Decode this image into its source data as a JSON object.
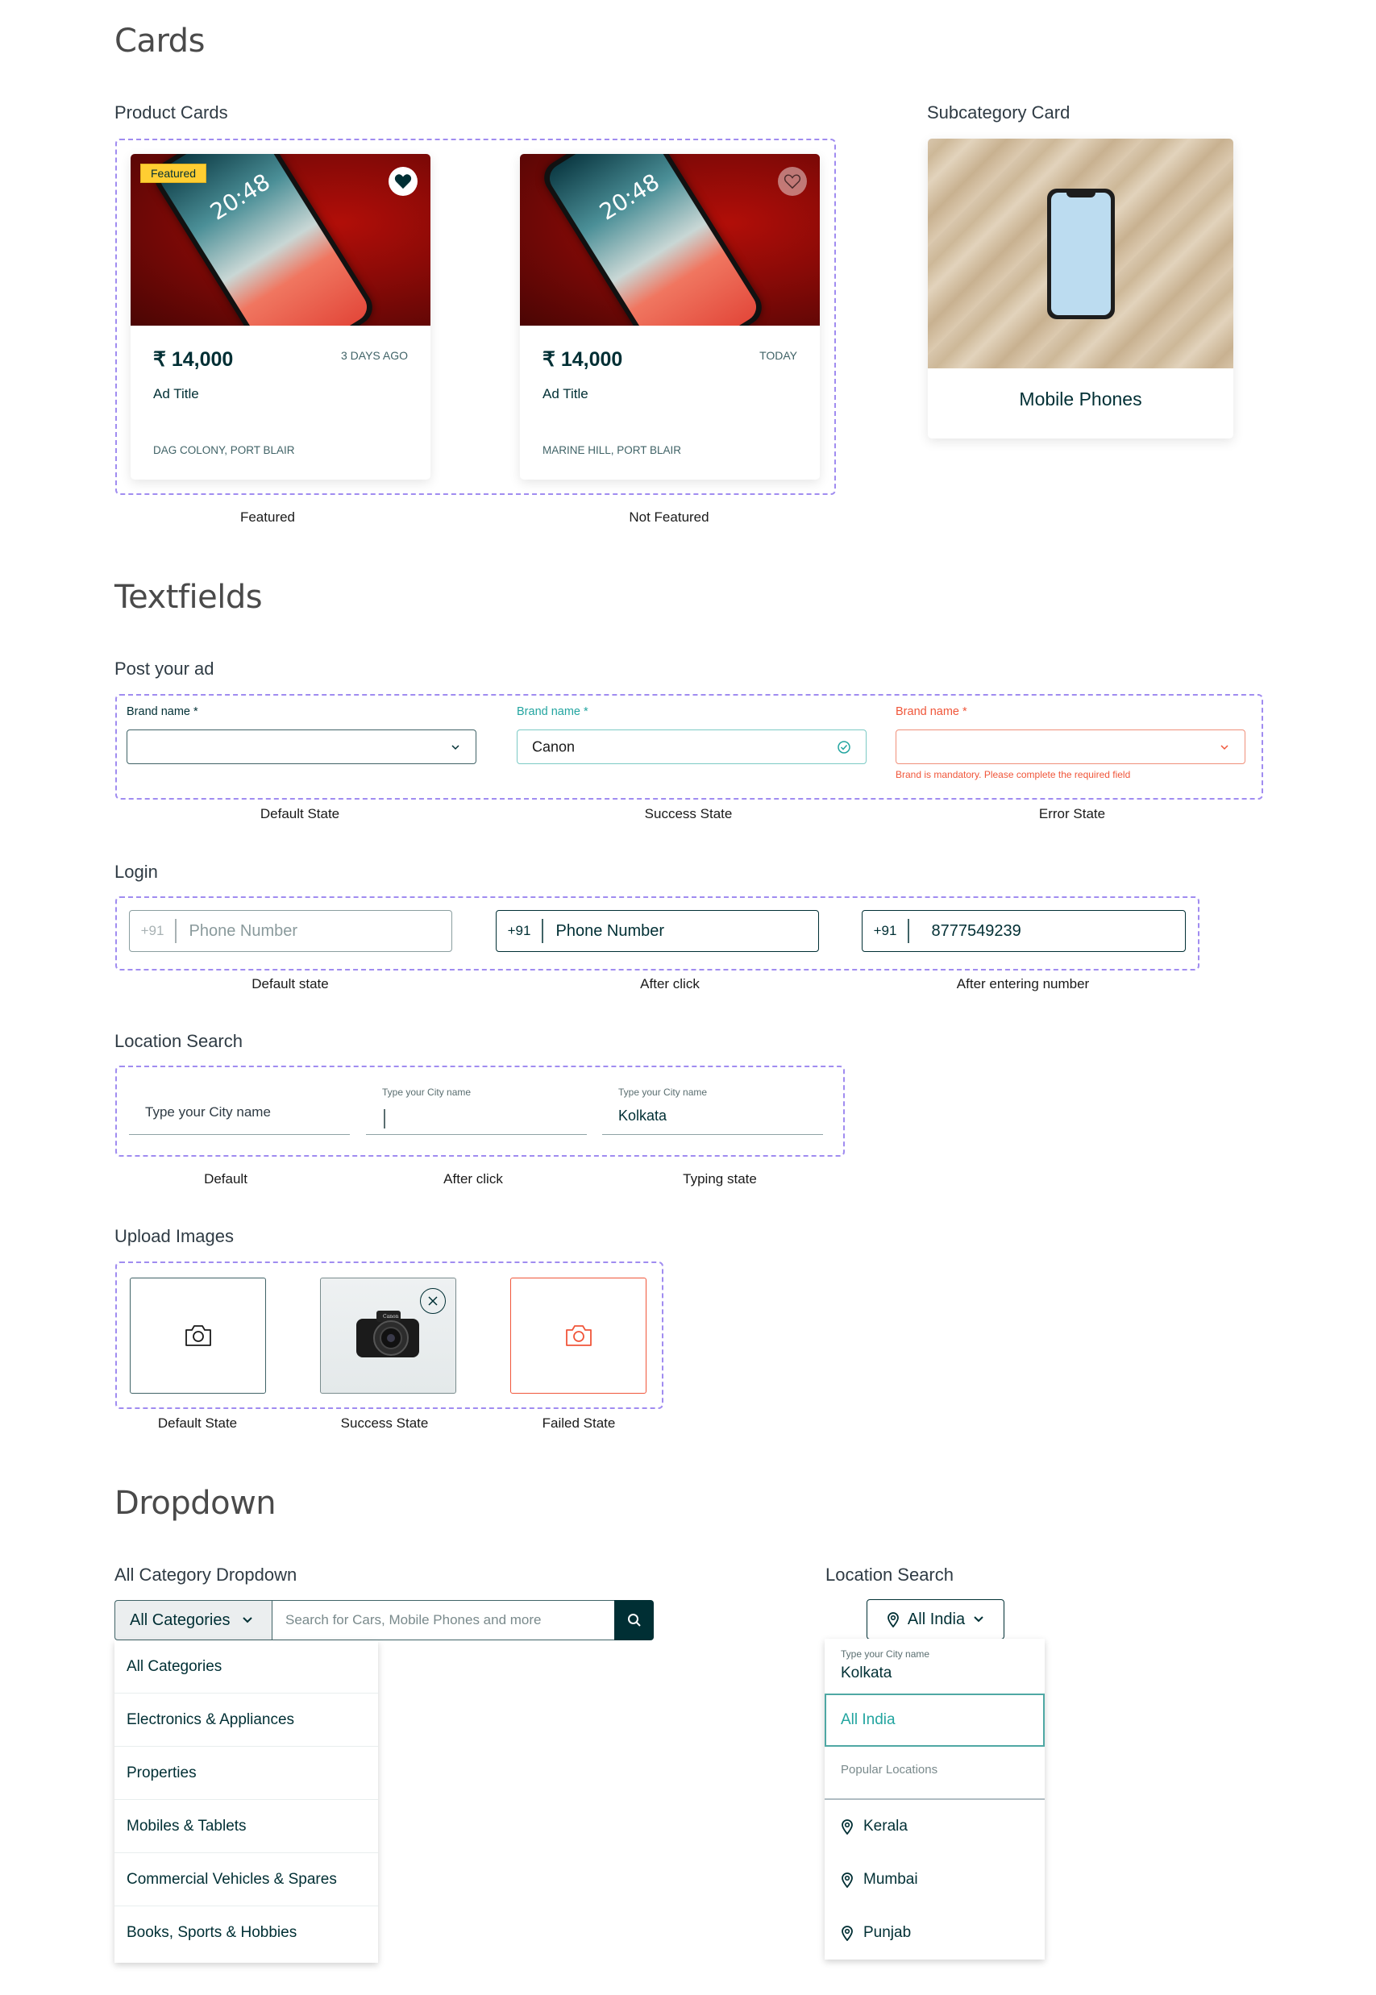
{
  "sections": {
    "cards": "Cards",
    "textfields": "Textfields",
    "dropdown": "Dropdown"
  },
  "product_cards": {
    "heading": "Product Cards",
    "items": [
      {
        "badge": "Featured",
        "favorited": true,
        "price": "₹ 14,000",
        "posted": "3 DAYS AGO",
        "title": "Ad Title",
        "location": "DAG COLONY, PORT BLAIR",
        "caption": "Featured",
        "phone_clock": "20:48"
      },
      {
        "badge": null,
        "favorited": false,
        "price": "₹ 14,000",
        "posted": "TODAY",
        "title": "Ad Title",
        "location": "MARINE HILL, PORT BLAIR",
        "caption": "Not Featured",
        "phone_clock": "20:48"
      }
    ]
  },
  "subcategory_card": {
    "heading": "Subcategory Card",
    "label": "Mobile Phones"
  },
  "post_ad": {
    "heading": "Post your ad",
    "fields": [
      {
        "label": "Brand name *",
        "value": "",
        "state": "default",
        "caption": "Default State"
      },
      {
        "label": "Brand name *",
        "value": "Canon",
        "state": "success",
        "caption": "Success State"
      },
      {
        "label": "Brand name *",
        "value": "",
        "state": "error",
        "error": "Brand is mandatory. Please complete the required field",
        "caption": "Error State"
      }
    ]
  },
  "login": {
    "heading": "Login",
    "fields": [
      {
        "country_code": "+91",
        "value": "Phone Number",
        "caption": "Default state"
      },
      {
        "country_code": "+91",
        "value": "Phone Number",
        "caption": "After click"
      },
      {
        "country_code": "+91",
        "value": "8777549239",
        "caption": "After entering number"
      }
    ]
  },
  "location_search": {
    "heading": "Location Search",
    "fields": [
      {
        "label": "",
        "placeholder": "Type your City name",
        "value": "",
        "caption": "Default"
      },
      {
        "label": "Type your City name",
        "value": "",
        "caption": "After click"
      },
      {
        "label": "Type your City name",
        "value": "Kolkata",
        "caption": "Typing state"
      }
    ]
  },
  "upload_images": {
    "heading": "Upload Images",
    "boxes": [
      {
        "state": "default",
        "caption": "Default State"
      },
      {
        "state": "success",
        "caption": "Success State",
        "camera_brand": "Canon"
      },
      {
        "state": "failed",
        "caption": "Failed State"
      }
    ]
  },
  "category_dropdown": {
    "heading": "All Category Dropdown",
    "selected": "All Categories",
    "search_placeholder": "Search for Cars, Mobile Phones and more",
    "options": [
      "All Categories",
      "Electronics & Appliances",
      "Properties",
      "Mobiles & Tablets",
      "Commercial Vehicles & Spares",
      "Books, Sports & Hobbies"
    ]
  },
  "location_dropdown": {
    "heading": "Location Search",
    "selected": "All India",
    "input_label": "Type your City name",
    "input_value": "Kolkata",
    "highlighted": "All India",
    "popular_heading": "Popular Locations",
    "popular": [
      "Kerala",
      "Mumbai",
      "Punjab"
    ]
  },
  "colors": {
    "primary": "#002f34",
    "success": "#23a5a0",
    "error": "#f0563a",
    "featured": "#ffce32",
    "guide": "#a08cf0"
  }
}
